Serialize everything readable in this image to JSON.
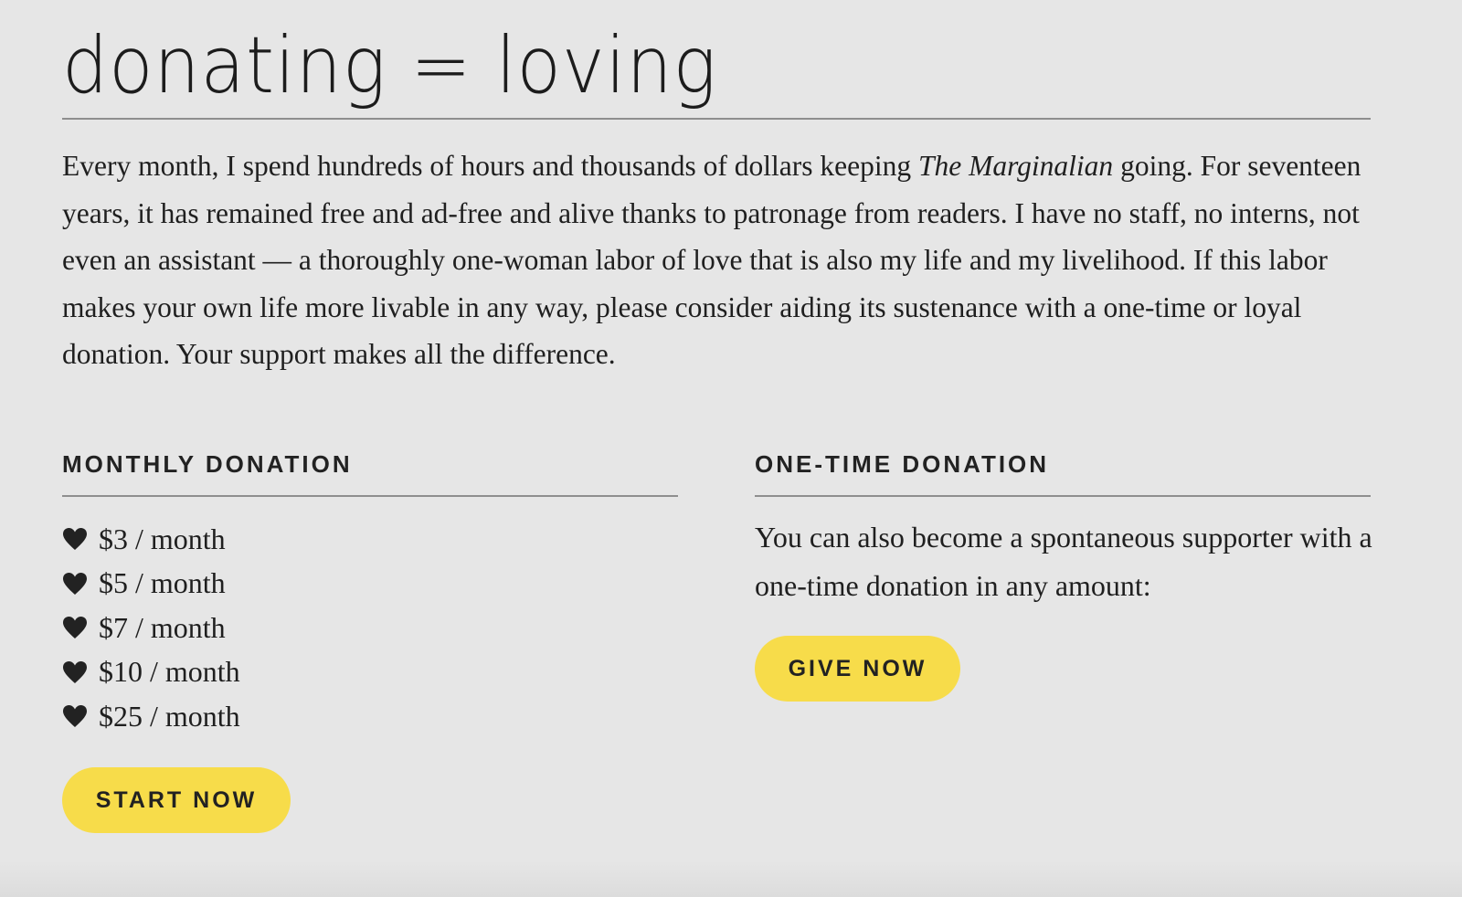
{
  "title": "donating = loving",
  "intro": {
    "part1": "Every month, I spend hundreds of hours and thousands of dollars keeping ",
    "publication": "The Marginalian",
    "part2": " going. For seventeen years, it has remained free and ad-free and alive thanks to patronage from readers. I have no staff, no interns, not even an assistant — a thoroughly one-woman labor of love that is also my life and my livelihood. If this labor makes your own life more livable in any way, please consider aiding its sustenance with a one-time or loyal donation. Your support makes all the difference."
  },
  "monthly": {
    "heading": "MONTHLY DONATION",
    "tiers": [
      {
        "label": "$3 / month",
        "icon": "heart-icon"
      },
      {
        "label": "$5 / month",
        "icon": "heart-icon"
      },
      {
        "label": "$7 / month",
        "icon": "heart-icon"
      },
      {
        "label": "$10 / month",
        "icon": "heart-icon"
      },
      {
        "label": "$25 / month",
        "icon": "heart-icon"
      }
    ],
    "button_label": "START NOW"
  },
  "one_time": {
    "heading": "ONE-TIME DONATION",
    "text": "You can also become a spontaneous supporter with a one-time donation in any amount:",
    "button_label": "GIVE NOW"
  },
  "colors": {
    "background": "#e6e6e6",
    "button": "#f7dc4a",
    "text": "#1f1f1f",
    "rule": "#8e8e8e"
  }
}
